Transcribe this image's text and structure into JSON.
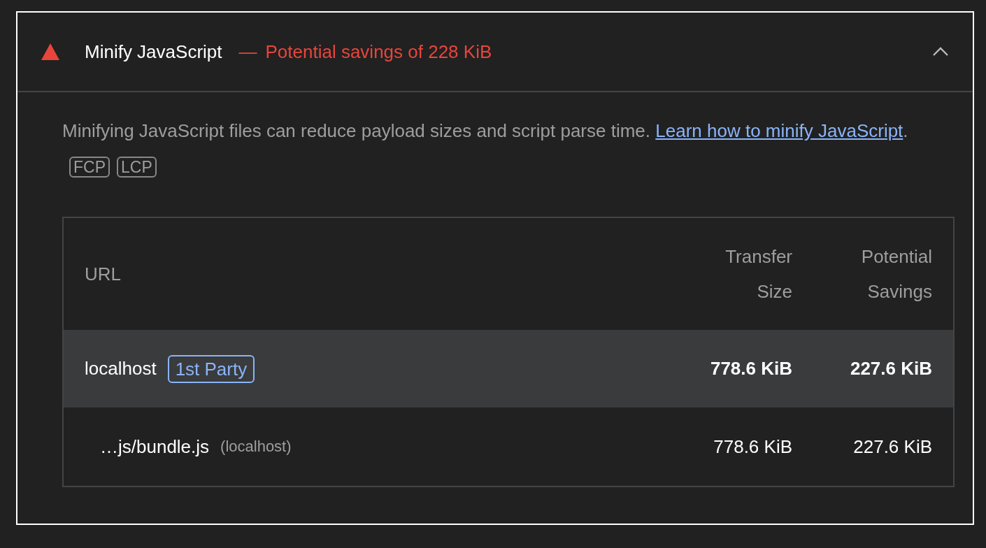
{
  "audit": {
    "kind": "fail",
    "title": "Minify JavaScript",
    "separator": "—",
    "savings": "Potential savings of 228 KiB",
    "expanded": true,
    "description": {
      "text": "Minifying JavaScript files can reduce payload sizes and script parse time.",
      "link": "Learn how to minify JavaScript",
      "after_link": ".",
      "tags": [
        "FCP",
        "LCP"
      ]
    },
    "table": {
      "columns": [
        {
          "label": "URL"
        },
        {
          "label": "Transfer Size"
        },
        {
          "label": "Potential Savings"
        }
      ],
      "rows": [
        {
          "kind": "group",
          "url": "localhost",
          "badge": "1st Party",
          "transfer_size": "778.6 KiB",
          "potential_savings": "227.6 KiB"
        },
        {
          "kind": "item",
          "url": "…js/bundle.js",
          "host": "(localhost)",
          "transfer_size": "778.6 KiB",
          "potential_savings": "227.6 KiB"
        }
      ]
    }
  }
}
